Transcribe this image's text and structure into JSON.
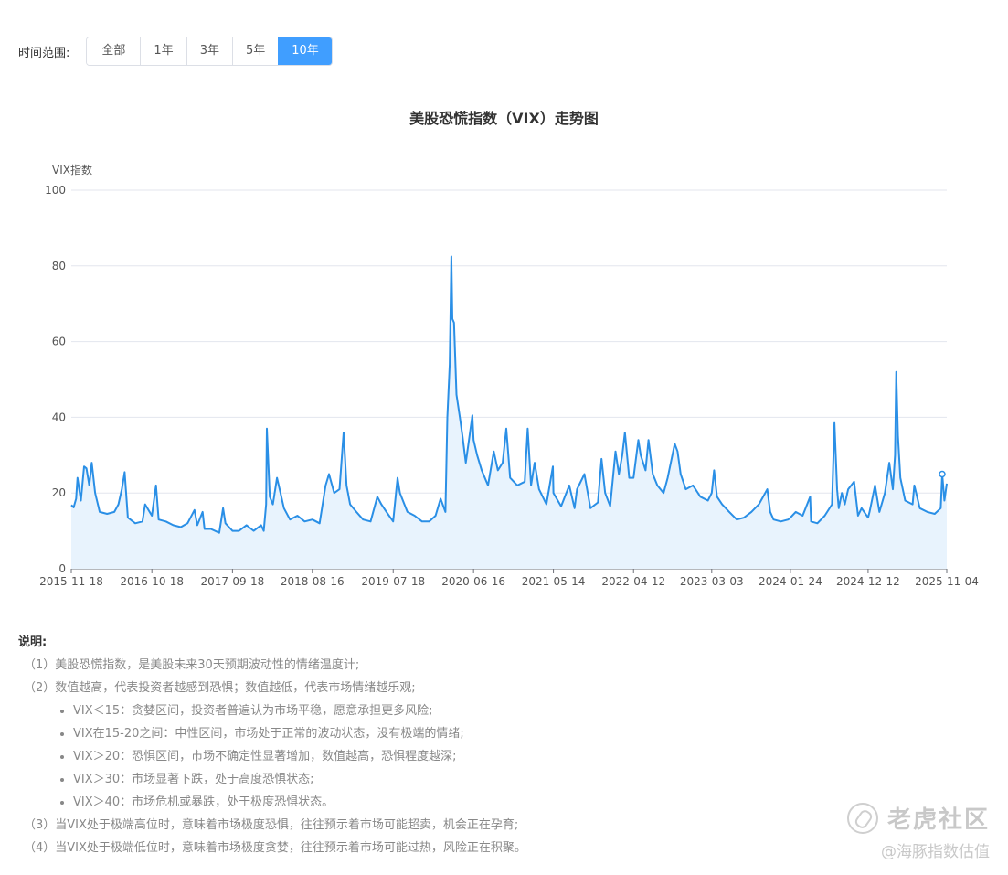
{
  "range_selector": {
    "label": "时间范围:",
    "options": [
      "全部",
      "1年",
      "3年",
      "5年",
      "10年"
    ],
    "active": "10年"
  },
  "colors": {
    "line": "#2a8fe6",
    "area": "#e8f3fd",
    "active_button": "#409eff",
    "grid": "#e3e6ee"
  },
  "chart_data": {
    "type": "area",
    "title": "美股恐慌指数（VIX）走势图",
    "ylabel": "VIX指数",
    "xlabel": "",
    "ylim": [
      0,
      100
    ],
    "yticks": [
      0,
      20,
      40,
      60,
      80,
      100
    ],
    "xlim": [
      "2015-11-18",
      "2025-11-04"
    ],
    "xticks": [
      "2015-11-18",
      "2016-10-18",
      "2017-09-18",
      "2018-08-16",
      "2019-07-18",
      "2020-06-16",
      "2021-05-14",
      "2022-04-12",
      "2023-03-03",
      "2024-01-24",
      "2024-12-12",
      "2025-11-04"
    ],
    "grid": true,
    "series": [
      {
        "x": [
          "2015-11-18",
          "2015-11-28",
          "2015-12-08",
          "2015-12-14",
          "2015-12-28",
          "2016-01-10",
          "2016-01-20",
          "2016-02-01",
          "2016-02-11",
          "2016-02-25",
          "2016-03-15",
          "2016-04-15",
          "2016-05-15",
          "2016-06-01",
          "2016-06-15",
          "2016-06-27",
          "2016-07-10",
          "2016-08-10",
          "2016-09-09",
          "2016-09-20",
          "2016-10-18",
          "2016-11-04",
          "2016-11-15",
          "2016-12-15",
          "2017-01-15",
          "2017-02-15",
          "2017-03-15",
          "2017-04-13",
          "2017-04-25",
          "2017-05-17",
          "2017-05-25",
          "2017-06-20",
          "2017-07-25",
          "2017-08-10",
          "2017-08-20",
          "2017-09-18",
          "2017-10-15",
          "2017-11-15",
          "2017-12-15",
          "2018-01-15",
          "2018-01-26",
          "2018-02-05",
          "2018-02-08",
          "2018-02-20",
          "2018-03-05",
          "2018-03-22",
          "2018-04-02",
          "2018-04-20",
          "2018-05-15",
          "2018-06-15",
          "2018-07-15",
          "2018-08-16",
          "2018-09-15",
          "2018-10-10",
          "2018-10-24",
          "2018-11-15",
          "2018-12-07",
          "2018-12-24",
          "2019-01-05",
          "2019-01-20",
          "2019-02-15",
          "2019-03-15",
          "2019-04-15",
          "2019-05-13",
          "2019-05-30",
          "2019-06-20",
          "2019-07-18",
          "2019-08-05",
          "2019-08-15",
          "2019-09-15",
          "2019-10-15",
          "2019-11-15",
          "2019-12-15",
          "2020-01-10",
          "2020-01-31",
          "2020-02-20",
          "2020-02-28",
          "2020-03-09",
          "2020-03-16",
          "2020-03-20",
          "2020-03-27",
          "2020-04-06",
          "2020-04-20",
          "2020-05-01",
          "2020-05-15",
          "2020-06-11",
          "2020-06-16",
          "2020-07-01",
          "2020-07-20",
          "2020-08-15",
          "2020-09-08",
          "2020-09-25",
          "2020-10-15",
          "2020-10-30",
          "2020-11-15",
          "2020-12-15",
          "2021-01-15",
          "2021-01-27",
          "2021-02-10",
          "2021-02-25",
          "2021-03-15",
          "2021-04-15",
          "2021-05-12",
          "2021-05-14",
          "2021-06-15",
          "2021-07-19",
          "2021-08-10",
          "2021-08-20",
          "2021-09-20",
          "2021-10-15",
          "2021-11-15",
          "2021-11-30",
          "2021-12-15",
          "2022-01-05",
          "2022-01-27",
          "2022-02-10",
          "2022-02-24",
          "2022-03-07",
          "2022-03-25",
          "2022-04-12",
          "2022-05-02",
          "2022-05-12",
          "2022-06-01",
          "2022-06-13",
          "2022-07-01",
          "2022-07-20",
          "2022-08-15",
          "2022-09-01",
          "2022-09-30",
          "2022-10-12",
          "2022-10-25",
          "2022-11-15",
          "2022-12-15",
          "2023-01-15",
          "2023-02-15",
          "2023-03-03",
          "2023-03-13",
          "2023-03-25",
          "2023-04-15",
          "2023-05-15",
          "2023-06-15",
          "2023-07-15",
          "2023-08-15",
          "2023-09-15",
          "2023-10-20",
          "2023-11-01",
          "2023-11-15",
          "2023-12-15",
          "2024-01-15",
          "2024-01-24",
          "2024-02-15",
          "2024-03-15",
          "2024-04-15",
          "2024-04-19",
          "2024-05-15",
          "2024-06-15",
          "2024-07-15",
          "2024-07-25",
          "2024-08-05",
          "2024-08-12",
          "2024-08-25",
          "2024-09-06",
          "2024-09-20",
          "2024-10-15",
          "2024-10-31",
          "2024-11-15",
          "2024-12-12",
          "2024-12-18",
          "2025-01-10",
          "2025-01-28",
          "2025-02-20",
          "2025-03-10",
          "2025-03-25",
          "2025-04-03",
          "2025-04-08",
          "2025-04-15",
          "2025-04-25",
          "2025-05-15",
          "2025-06-15",
          "2025-06-22",
          "2025-07-15",
          "2025-08-15",
          "2025-09-15",
          "2025-10-10",
          "2025-10-16",
          "2025-10-25",
          "2025-11-04"
        ],
        "y": [
          16.8,
          16.2,
          18.5,
          24.0,
          18.0,
          27.0,
          26.5,
          22.0,
          28.0,
          20.0,
          15.0,
          14.5,
          15.0,
          17.0,
          21.0,
          25.5,
          13.5,
          12.0,
          12.5,
          17.0,
          14.0,
          22.0,
          13.0,
          12.5,
          11.5,
          11.0,
          12.0,
          15.5,
          11.5,
          15.0,
          10.5,
          10.5,
          9.5,
          16.0,
          12.0,
          10.0,
          10.0,
          11.5,
          10.0,
          11.5,
          10.0,
          17.0,
          37.0,
          19.0,
          17.0,
          24.0,
          21.0,
          16.0,
          13.0,
          14.0,
          12.5,
          13.0,
          12.0,
          22.0,
          25.0,
          20.0,
          21.0,
          36.0,
          22.0,
          17.0,
          15.0,
          13.0,
          12.5,
          19.0,
          17.0,
          15.0,
          12.5,
          24.0,
          20.0,
          15.0,
          14.0,
          12.5,
          12.5,
          14.0,
          18.5,
          15.0,
          40.0,
          54.0,
          82.5,
          66.0,
          65.0,
          46.0,
          40.0,
          35.0,
          28.0,
          40.5,
          34.0,
          30.0,
          26.0,
          22.0,
          31.0,
          26.0,
          28.0,
          37.0,
          24.0,
          22.0,
          23.0,
          37.0,
          22.0,
          28.0,
          21.0,
          17.0,
          27.0,
          20.0,
          16.5,
          22.0,
          16.0,
          21.0,
          25.0,
          16.0,
          17.5,
          29.0,
          20.0,
          16.5,
          31.0,
          25.0,
          30.0,
          36.0,
          24.0,
          24.0,
          34.0,
          30.0,
          26.0,
          34.0,
          25.0,
          22.0,
          20.0,
          24.0,
          33.0,
          31.0,
          25.0,
          21.0,
          22.0,
          19.0,
          18.0,
          20.0,
          26.0,
          19.0,
          17.0,
          15.0,
          13.0,
          13.5,
          15.0,
          17.0,
          21.0,
          15.0,
          13.0,
          12.5,
          13.0,
          13.5,
          15.0,
          14.0,
          19.0,
          12.5,
          12.0,
          14.0,
          17.0,
          38.5,
          21.0,
          16.0,
          20.0,
          17.0,
          21.0,
          23.0,
          14.0,
          16.0,
          13.5,
          15.0,
          22.0,
          15.0,
          20.0,
          28.0,
          21.0,
          30.0,
          52.0,
          35.0,
          24.0,
          18.0,
          17.0,
          22.0,
          16.0,
          15.0,
          14.5,
          16.0,
          25.0,
          18.0,
          22.5
        ]
      }
    ]
  },
  "notes": {
    "title": "说明:",
    "items": [
      "（1）美股恐慌指数，是美股未来30天预期波动性的情绪温度计;",
      "（2）数值越高，代表投资者越感到恐惧；数值越低，代表市场情绪越乐观;"
    ],
    "bullets": [
      "VIX＜15：贪婪区间，投资者普遍认为市场平稳，愿意承担更多风险;",
      "VIX在15-20之间：中性区间，市场处于正常的波动状态，没有极端的情绪;",
      "VIX＞20：恐惧区间，市场不确定性显著增加，数值越高，恐惧程度越深;",
      "VIX＞30：市场显著下跌，处于高度恐惧状态;",
      "VIX＞40：市场危机或暴跌，处于极度恐惧状态。"
    ],
    "tail": [
      "（3）当VIX处于极端高位时，意味着市场极度恐惧，往往预示着市场可能超卖，机会正在孕育;",
      "（4）当VIX处于极端低位时，意味着市场极度贪婪，往往预示着市场可能过热，风险正在积聚。"
    ]
  },
  "watermark": {
    "brand": "老虎社区",
    "sub": "@海豚指数估值",
    "icon": "tiger-logo-icon"
  }
}
